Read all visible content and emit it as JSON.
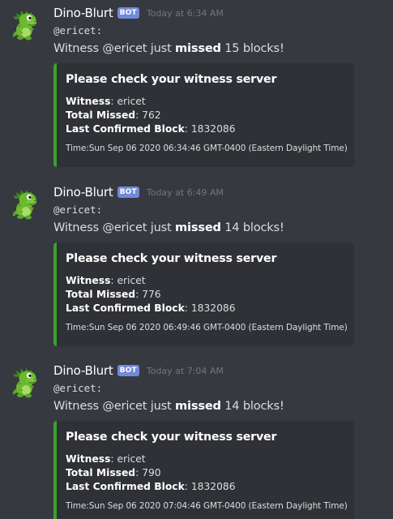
{
  "colors": {
    "background": "#36393f",
    "embed_background": "#2f3136",
    "embed_accent": "#3ea02b",
    "bot_tag": "#7289da",
    "timestamp": "#72767d"
  },
  "messages": [
    {
      "author": "Dino-Blurt",
      "bot_tag": "BOT",
      "timestamp": "Today at 6:34 AM",
      "mention": "@ericet:",
      "text_before": "Witness @ericet just ",
      "text_bold": "missed",
      "text_after": " 15 blocks!",
      "embed": {
        "title": "Please check your witness server",
        "witness_key": "Witness",
        "witness_value": ": ericet",
        "missed_key": "Total Missed",
        "missed_value": ": 762",
        "block_key": "Last Confirmed Block",
        "block_value": ": 1832086",
        "footer": "Time:Sun Sep 06 2020 06:34:46 GMT-0400 (Eastern Daylight Time)"
      }
    },
    {
      "author": "Dino-Blurt",
      "bot_tag": "BOT",
      "timestamp": "Today at 6:49 AM",
      "mention": "@ericet:",
      "text_before": "Witness @ericet just ",
      "text_bold": "missed",
      "text_after": " 14 blocks!",
      "embed": {
        "title": "Please check your witness server",
        "witness_key": "Witness",
        "witness_value": ": ericet",
        "missed_key": "Total Missed",
        "missed_value": ": 776",
        "block_key": "Last Confirmed Block",
        "block_value": ": 1832086",
        "footer": "Time:Sun Sep 06 2020 06:49:46 GMT-0400 (Eastern Daylight Time)"
      }
    },
    {
      "author": "Dino-Blurt",
      "bot_tag": "BOT",
      "timestamp": "Today at 7:04 AM",
      "mention": "@ericet:",
      "text_before": "Witness @ericet just ",
      "text_bold": "missed",
      "text_after": " 14 blocks!",
      "embed": {
        "title": "Please check your witness server",
        "witness_key": "Witness",
        "witness_value": ": ericet",
        "missed_key": "Total Missed",
        "missed_value": ": 790",
        "block_key": "Last Confirmed Block",
        "block_value": ": 1832086",
        "footer": "Time:Sun Sep 06 2020 07:04:46 GMT-0400 (Eastern Daylight Time)"
      }
    }
  ]
}
